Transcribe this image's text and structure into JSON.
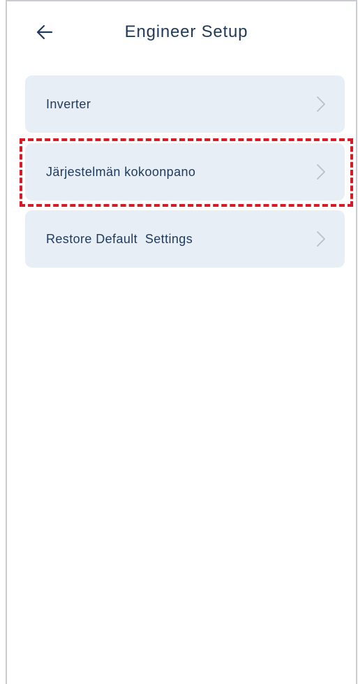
{
  "header": {
    "title": "Engineer Setup",
    "back_icon": "arrow-left-icon"
  },
  "menu": {
    "items": [
      {
        "label": "Inverter",
        "icon": "chevron-right-icon"
      },
      {
        "label": "Järjestelmän kokoonpano",
        "icon": "chevron-right-icon"
      },
      {
        "label": "Restore Default  Settings",
        "icon": "chevron-right-icon"
      }
    ]
  },
  "colors": {
    "title_text": "#1f3a5a",
    "item_background": "#e8eef5",
    "chevron": "#b8c0ca",
    "highlight_border": "#d61a26"
  }
}
